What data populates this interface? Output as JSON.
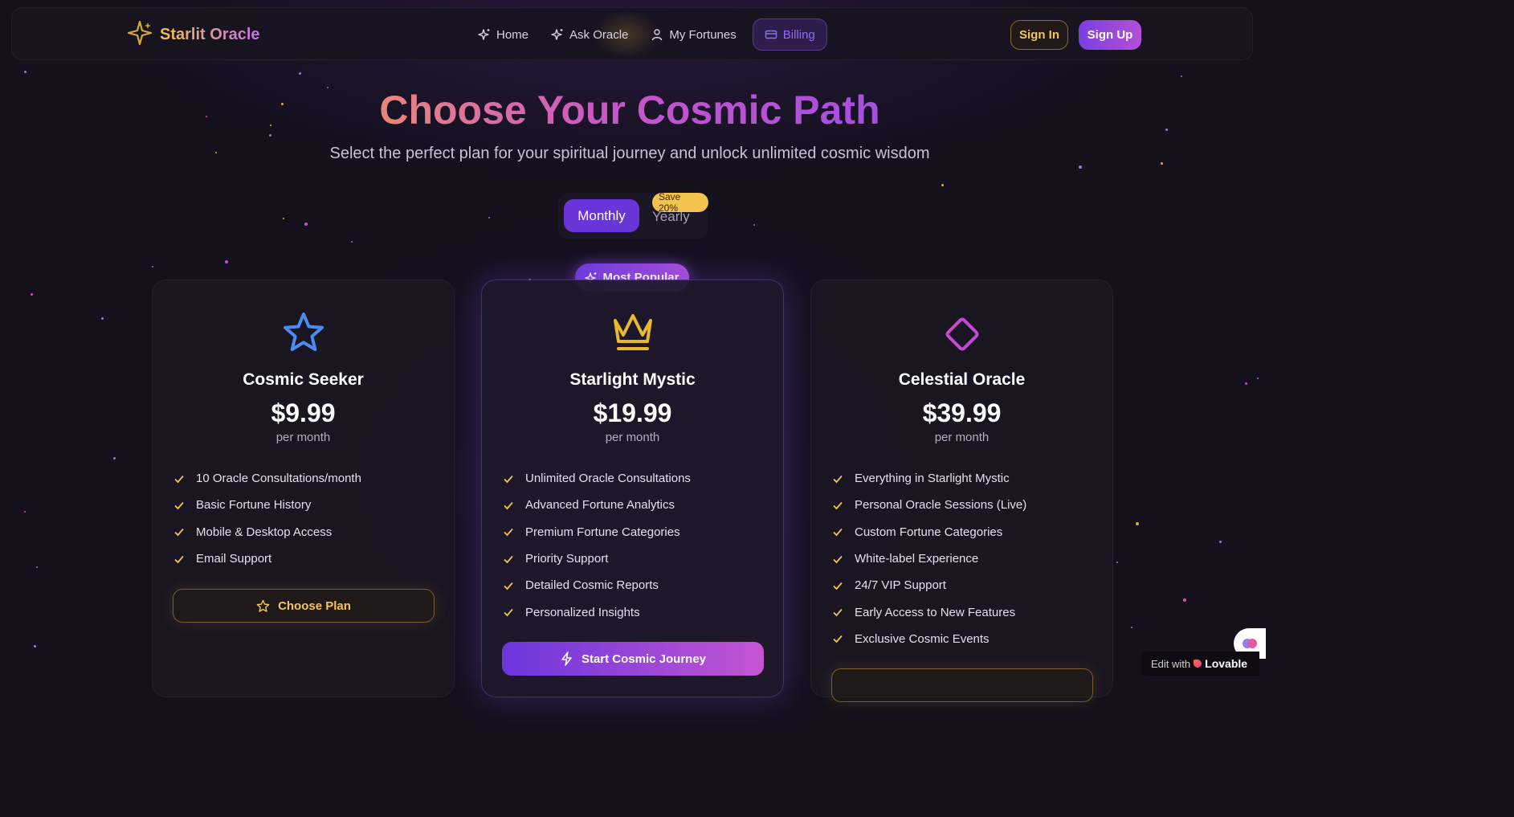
{
  "app": {
    "brand": "Starlit Oracle"
  },
  "nav": {
    "items": [
      {
        "label": "Home",
        "icon": "sparkles-icon"
      },
      {
        "label": "Ask Oracle",
        "icon": "sparkles-icon"
      },
      {
        "label": "My Fortunes",
        "icon": "user-icon"
      },
      {
        "label": "Billing",
        "icon": "credit-card-icon",
        "active": true
      }
    ],
    "sign_in": "Sign In",
    "sign_up": "Sign Up"
  },
  "hero": {
    "title": "Choose Your Cosmic Path",
    "subtitle": "Select the perfect plan for your spiritual journey and unlock unlimited cosmic wisdom"
  },
  "billing_toggle": {
    "monthly": "Monthly",
    "yearly": "Yearly",
    "save_badge": "Save 20%",
    "selected": "Monthly"
  },
  "popular_badge": "Most Popular",
  "plans": [
    {
      "name": "Cosmic Seeker",
      "price": "$9.99",
      "period": "per month",
      "icon": "star-icon",
      "features": [
        "10 Oracle Consultations/month",
        "Basic Fortune History",
        "Mobile & Desktop Access",
        "Email Support"
      ],
      "button": "Choose Plan"
    },
    {
      "name": "Starlight Mystic",
      "price": "$19.99",
      "period": "per month",
      "icon": "crown-icon",
      "features": [
        "Unlimited Oracle Consultations",
        "Advanced Fortune Analytics",
        "Premium Fortune Categories",
        "Priority Support",
        "Detailed Cosmic Reports",
        "Personalized Insights"
      ],
      "button": "Start Cosmic Journey"
    },
    {
      "name": "Celestial Oracle",
      "price": "$39.99",
      "period": "per month",
      "icon": "diamond-icon",
      "features": [
        "Everything in Starlight Mystic",
        "Personal Oracle Sessions (Live)",
        "Custom Fortune Categories",
        "White-label Experience",
        "24/7 VIP Support",
        "Early Access to New Features",
        "Exclusive Cosmic Events"
      ]
    }
  ],
  "lovable": {
    "prefix": "Edit with",
    "name": "Lovable"
  },
  "colors": {
    "background": "#14101c",
    "accent_purple": "#6a35d8",
    "accent_gold": "#f2c65a",
    "check_gold": "#f2c34e",
    "star_blue": "#4a8cf0",
    "diamond_pink": "#c44ad6"
  }
}
